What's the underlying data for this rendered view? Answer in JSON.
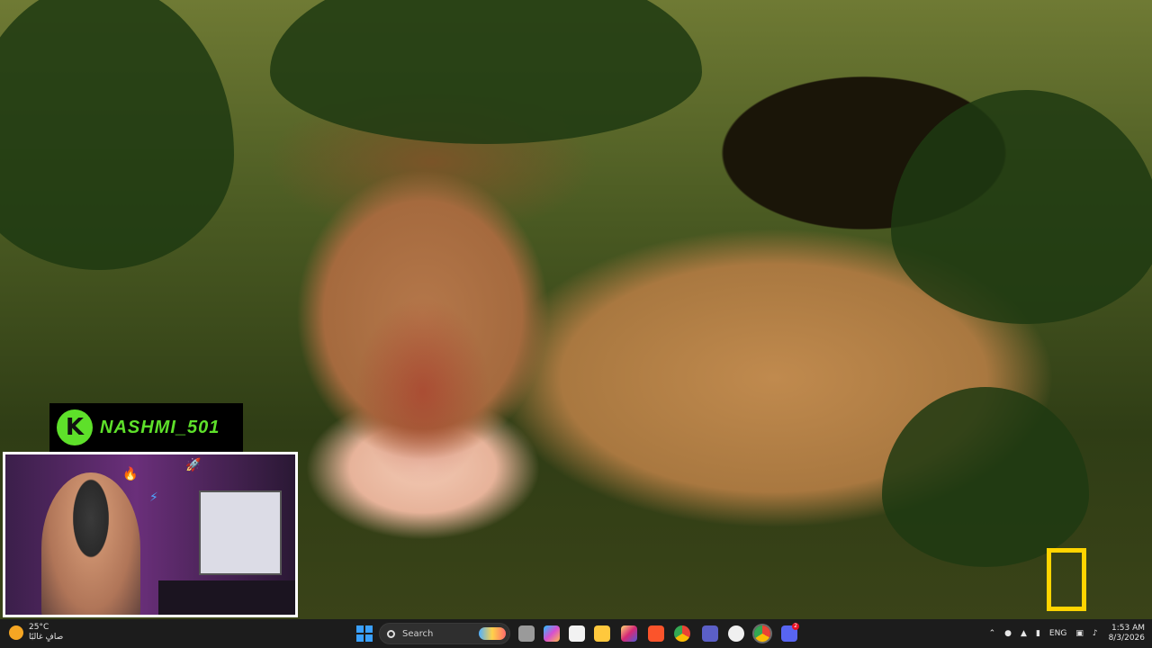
{
  "overlay": {
    "streamer_name": "NASHMI_501",
    "badge_letter": "K"
  },
  "logo": {
    "name": "national-geographic-logo",
    "color": "#ffd400"
  },
  "taskbar": {
    "weather": {
      "temp": "25°C",
      "condition": "صافٍ غالبًا"
    },
    "search_placeholder": "Search",
    "apps": [
      "task-view",
      "copilot",
      "store",
      "file-explorer",
      "instagram",
      "brave",
      "chrome",
      "teams",
      "github",
      "chrome-profile",
      "discord"
    ],
    "tray": {
      "language": "ENG",
      "time": "1:53 AM",
      "date": "8/3/2026",
      "discord_badge": "2"
    }
  }
}
